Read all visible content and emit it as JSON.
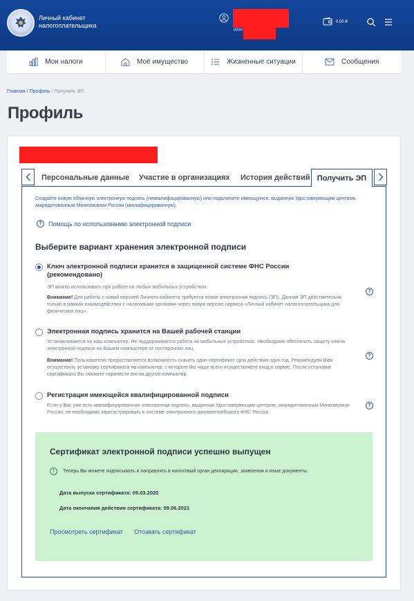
{
  "header": {
    "brand_line1": "Личный кабинет",
    "brand_line2": "налогоплательщика",
    "inn_label": "ИНН",
    "balance": "0.00 ₽",
    "icons": [
      "user-icon",
      "wallet-icon",
      "search-icon",
      "menu-icon"
    ]
  },
  "nav": {
    "items": [
      {
        "label": "Мои налоги",
        "icon": "taxes-icon"
      },
      {
        "label": "Моё имущество",
        "icon": "property-icon"
      },
      {
        "label": "Жизненные ситуации",
        "icon": "list-icon"
      },
      {
        "label": "Сообщения",
        "icon": "envelope-icon"
      }
    ]
  },
  "breadcrumb": {
    "items": [
      "Главная",
      "Профиль",
      "Получить ЭП"
    ],
    "separator": " / "
  },
  "page": {
    "title": "Профиль"
  },
  "tabs": {
    "items": [
      "Персональные данные",
      "Участие в организациях",
      "История действий",
      "Получить ЭП"
    ],
    "active": "Получить ЭП"
  },
  "panel": {
    "intro": "Создайте новую облачную электронную подпись (неквалифицированную) или подключите имеющуюся, выданную Удостоверяющим центром, аккредитованным Минкомсвязи России (квалифицированную).",
    "help_link": "Помощь по использованию электронной подписи",
    "section_title": "Выберите вариант хранения электронной подписи",
    "options": [
      {
        "title": "Ключ электронной подписи хранится в защищенной системе ФНС России (рекомендовано)",
        "checked": true,
        "desc": "ЭП можно использовать при работе на любых мобильных устройствах.",
        "warning_label": "Внимание!",
        "warning": "Для работы с новой версией Личного кабинета требуется новая электронная подпись (ЭП). Данная ЭП действительна только в рамках взаимодействия с налоговыми органами через новую версию сервиса «Личный кабинет налогоплательщика для физических лиц»."
      },
      {
        "title": "Электронная подпись хранится на Вашей рабочей станции",
        "checked": false,
        "desc": "Устанавливается на ваш компьютер. Не поддерживается работа на мобильных устройствах. Необходимо обеспечить защиту ключа электронной подписи на Вашем компьютере от посторонних лиц.",
        "warning_label": "Внимание!",
        "warning": "Пользователю предоставляется возможность скачать один сертификат срок действия один год. Рекомендуем Вам осуществить установку сертификата на компьютер, с которого Вы чаще всего осуществляете вход в сервис. После установки сертификата Вы сможете перенести его на другой компьютер."
      },
      {
        "title": "Регистрация имеющейся квалифицированной подписи",
        "checked": false,
        "desc": "Если у Вас уже есть квалифицированная электронная подпись, выданная Удостоверяющим центром, аккредитованным Минкомсвязи России, ее необходимо зарегистрировать в системе электронного документооборота ФНС России."
      }
    ]
  },
  "success": {
    "title": "Сертификат электронной подписи успешно выпущен",
    "note": "Теперь Вы можете подписывать и направлять в налоговый орган декларации, заявления и иные документы.",
    "issue_label": "Дата выпуска сертификата: ",
    "issue_date": "09.03.2020",
    "expiry_label": "Дата окончания действия сертификата: ",
    "expiry_date": "09.06.2021",
    "view_link": "Просмотреть сертификат",
    "revoke_link": "Отозвать сертификат"
  },
  "colors": {
    "header_bg": "#14479b",
    "accent": "#1f4fa0",
    "link": "#2a5aa8",
    "success_bg": "#cdf2cf",
    "redaction": "#ff1d1d"
  }
}
